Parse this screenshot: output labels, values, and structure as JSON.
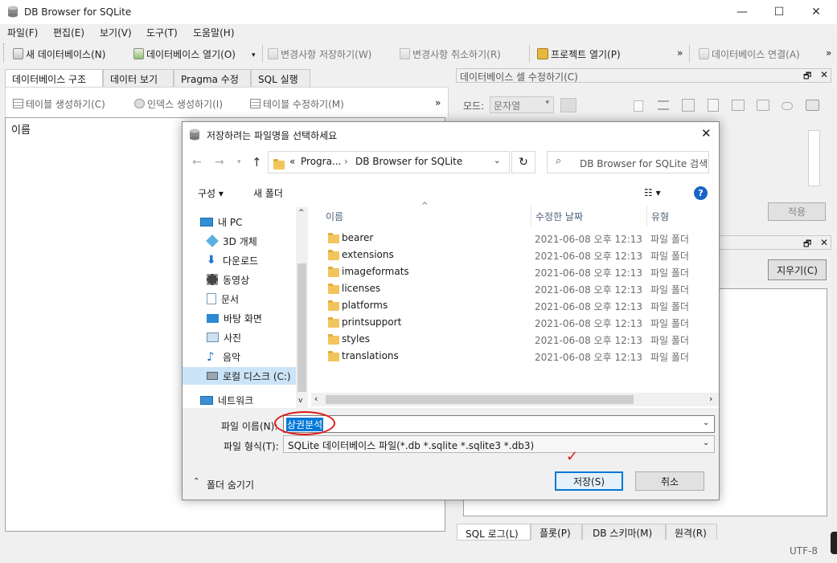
{
  "window": {
    "title": "DB Browser for SQLite",
    "minimize": "—",
    "maximize": "☐",
    "close": "✕"
  },
  "menubar": [
    "파일(F)",
    "편집(E)",
    "보기(V)",
    "도구(T)",
    "도움말(H)"
  ],
  "toolbar": {
    "new_db": "새 데이터베이스(N)",
    "open_db": "데이터베이스 열기(O)",
    "dropdown": "▾",
    "write": "변경사항 저장하기(W)",
    "revert": "변경사항 취소하기(R)",
    "open_project": "프로젝트 열기(P)",
    "more": "»",
    "attach": "데이터베이스 연결(A)",
    "more2": "»"
  },
  "left_tabs": [
    "데이터베이스 구조",
    "데이터 보기",
    "Pragma 수정",
    "SQL 실행"
  ],
  "left_toolbar": {
    "create_table": "테이블 생성하기(C)",
    "create_index": "인덱스 생성하기(I)",
    "modify_table": "테이블 수정하기(M)",
    "more": "»"
  },
  "tree_header": "이름",
  "edit_cell": {
    "title": "데이터베이스 셀 수정하기(C)",
    "mode_label": "모드:",
    "mode_value": "문자열",
    "apply": "적용",
    "float": "🗗",
    "close": "✕"
  },
  "second_panel": {
    "float": "🗗",
    "close": "✕",
    "clear": "지우기(C)"
  },
  "bottom_tabs": [
    "SQL 로그(L)",
    "플롯(P)",
    "DB 스키마(M)",
    "원격(R)"
  ],
  "status": {
    "encoding": "UTF-8"
  },
  "dialog": {
    "title": "저장하려는 파일명을 선택하세요",
    "close": "✕",
    "path": [
      "«",
      "Progra...",
      "›",
      "DB Browser for SQLite"
    ],
    "search_placeholder": "DB Browser for SQLite 검색",
    "organize": "구성 ▾",
    "new_folder": "새 폴더",
    "help": "?",
    "nav": [
      {
        "label": "내 PC",
        "icon": "pc-icon"
      },
      {
        "label": "3D 개체",
        "icon": "cube-icon"
      },
      {
        "label": "다운로드",
        "icon": "download-icon"
      },
      {
        "label": "동영상",
        "icon": "video-icon"
      },
      {
        "label": "문서",
        "icon": "document-icon"
      },
      {
        "label": "바탕 화면",
        "icon": "desktop-icon"
      },
      {
        "label": "사진",
        "icon": "picture-icon"
      },
      {
        "label": "음악",
        "icon": "music-icon"
      },
      {
        "label": "로컬 디스크 (C:)",
        "icon": "disk-icon"
      },
      {
        "label": "네트워크",
        "icon": "network-icon"
      }
    ],
    "columns": {
      "name": "이름",
      "modified": "수정한 날짜",
      "type": "유형"
    },
    "files": [
      {
        "name": "bearer",
        "date": "2021-06-08 오후 12:13",
        "type": "파일 폴더"
      },
      {
        "name": "extensions",
        "date": "2021-06-08 오후 12:13",
        "type": "파일 폴더"
      },
      {
        "name": "imageformats",
        "date": "2021-06-08 오후 12:13",
        "type": "파일 폴더"
      },
      {
        "name": "licenses",
        "date": "2021-06-08 오후 12:13",
        "type": "파일 폴더"
      },
      {
        "name": "platforms",
        "date": "2021-06-08 오후 12:13",
        "type": "파일 폴더"
      },
      {
        "name": "printsupport",
        "date": "2021-06-08 오후 12:13",
        "type": "파일 폴더"
      },
      {
        "name": "styles",
        "date": "2021-06-08 오후 12:13",
        "type": "파일 폴더"
      },
      {
        "name": "translations",
        "date": "2021-06-08 오후 12:13",
        "type": "파일 폴더"
      }
    ],
    "filename_label": "파일 이름(N):",
    "filename_value": "상권분석",
    "filetype_label": "파일 형식(T):",
    "filetype_value": "SQLite 데이터베이스 파일(*.db *.sqlite *.sqlite3 *.db3)",
    "hide_folders": "폴더 숨기기",
    "save": "저장(S)",
    "cancel": "취소"
  },
  "colors": {
    "selection": "#0078d7",
    "annotation_red": "#e01818",
    "accent_blue": "#1a63c7"
  }
}
